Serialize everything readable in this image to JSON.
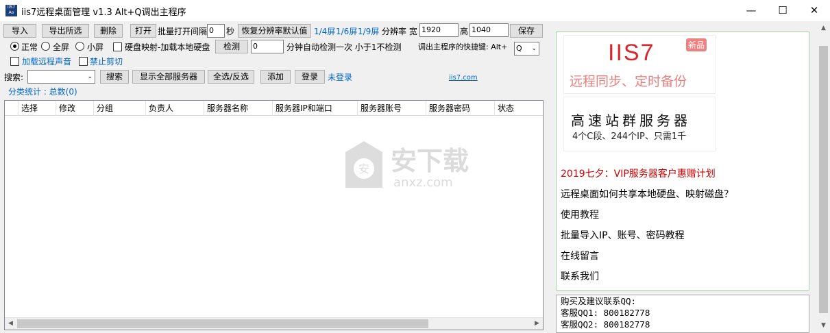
{
  "window": {
    "title": "iis7远程桌面管理 v1.3 Alt+Q调出主程序",
    "icon_text": "IIS7 Ao",
    "minimize_icon": "minimize-icon",
    "maximize_icon": "maximize-icon",
    "close_icon": "close-icon"
  },
  "toolbar": {
    "import": "导入",
    "export_selected": "导出所选",
    "delete": "删除",
    "open": "打开",
    "batch_interval_label": "批量打开间隔",
    "batch_interval_value": "0",
    "seconds": "秒",
    "restore_resolution": "恢复分辨率默认值",
    "screen_quarter": "1/4屏",
    "screen_sixth": "1/6屏",
    "screen_ninth": "1/9屏",
    "resolution_label": "分辨率 宽",
    "width_value": "1920",
    "height_label": "高",
    "height_value": "1040",
    "save": "保存"
  },
  "options": {
    "mode_normal": "正常",
    "mode_fullscreen": "全屏",
    "mode_small": "小屏",
    "disk_mapping": "硬盘映射-加载本地硬盘",
    "detect": "检测",
    "detect_minutes": "0",
    "detect_text": "分钟自动检测一次 小于1不检测",
    "hotkey_label": "调出主程序的快捷键: Alt+",
    "hotkey_value": "Q",
    "remote_sound": "加载远程声音",
    "disable_clipboard": "禁止剪切"
  },
  "search": {
    "label": "搜索:",
    "value": "",
    "search_button": "搜索",
    "show_all": "显示全部服务器",
    "select_all": "全选/反选",
    "add": "添加",
    "login": "登录",
    "login_status": "未登录",
    "site_link": "iis7.com"
  },
  "stats": "分类统计 : 总数(0)",
  "table": {
    "columns": [
      "选择",
      "修改",
      "分组",
      "负责人",
      "服务器名称",
      "服务器IP和端口",
      "服务器账号",
      "服务器密码",
      "状态"
    ],
    "rows": []
  },
  "watermark": {
    "text": "安下载",
    "sub": "anxz.com"
  },
  "ads": {
    "ad1_brand": "IIS7",
    "ad1_badge": "新品",
    "ad1_slogan": "远程同步、定时备份",
    "ad2_title": "高速站群服务器",
    "ad2_sub": "4个C段、244个IP、只需1千",
    "links": [
      "2019七夕：VIP服务器客户惠赠计划",
      "远程桌面如何共享本地硬盘、映射磁盘？",
      "使用教程",
      "批量导入IP、账号、密码教程",
      "在线留言",
      "联系我们"
    ]
  },
  "contact": {
    "title": "购买及建议联系QQ:",
    "qq1": "客服QQ1: 800182778",
    "qq2": "客服QQ2: 800182778"
  },
  "colors": {
    "accent_red": "#d9262c",
    "link_blue": "#0066cc",
    "promo_red": "#cc0000"
  }
}
